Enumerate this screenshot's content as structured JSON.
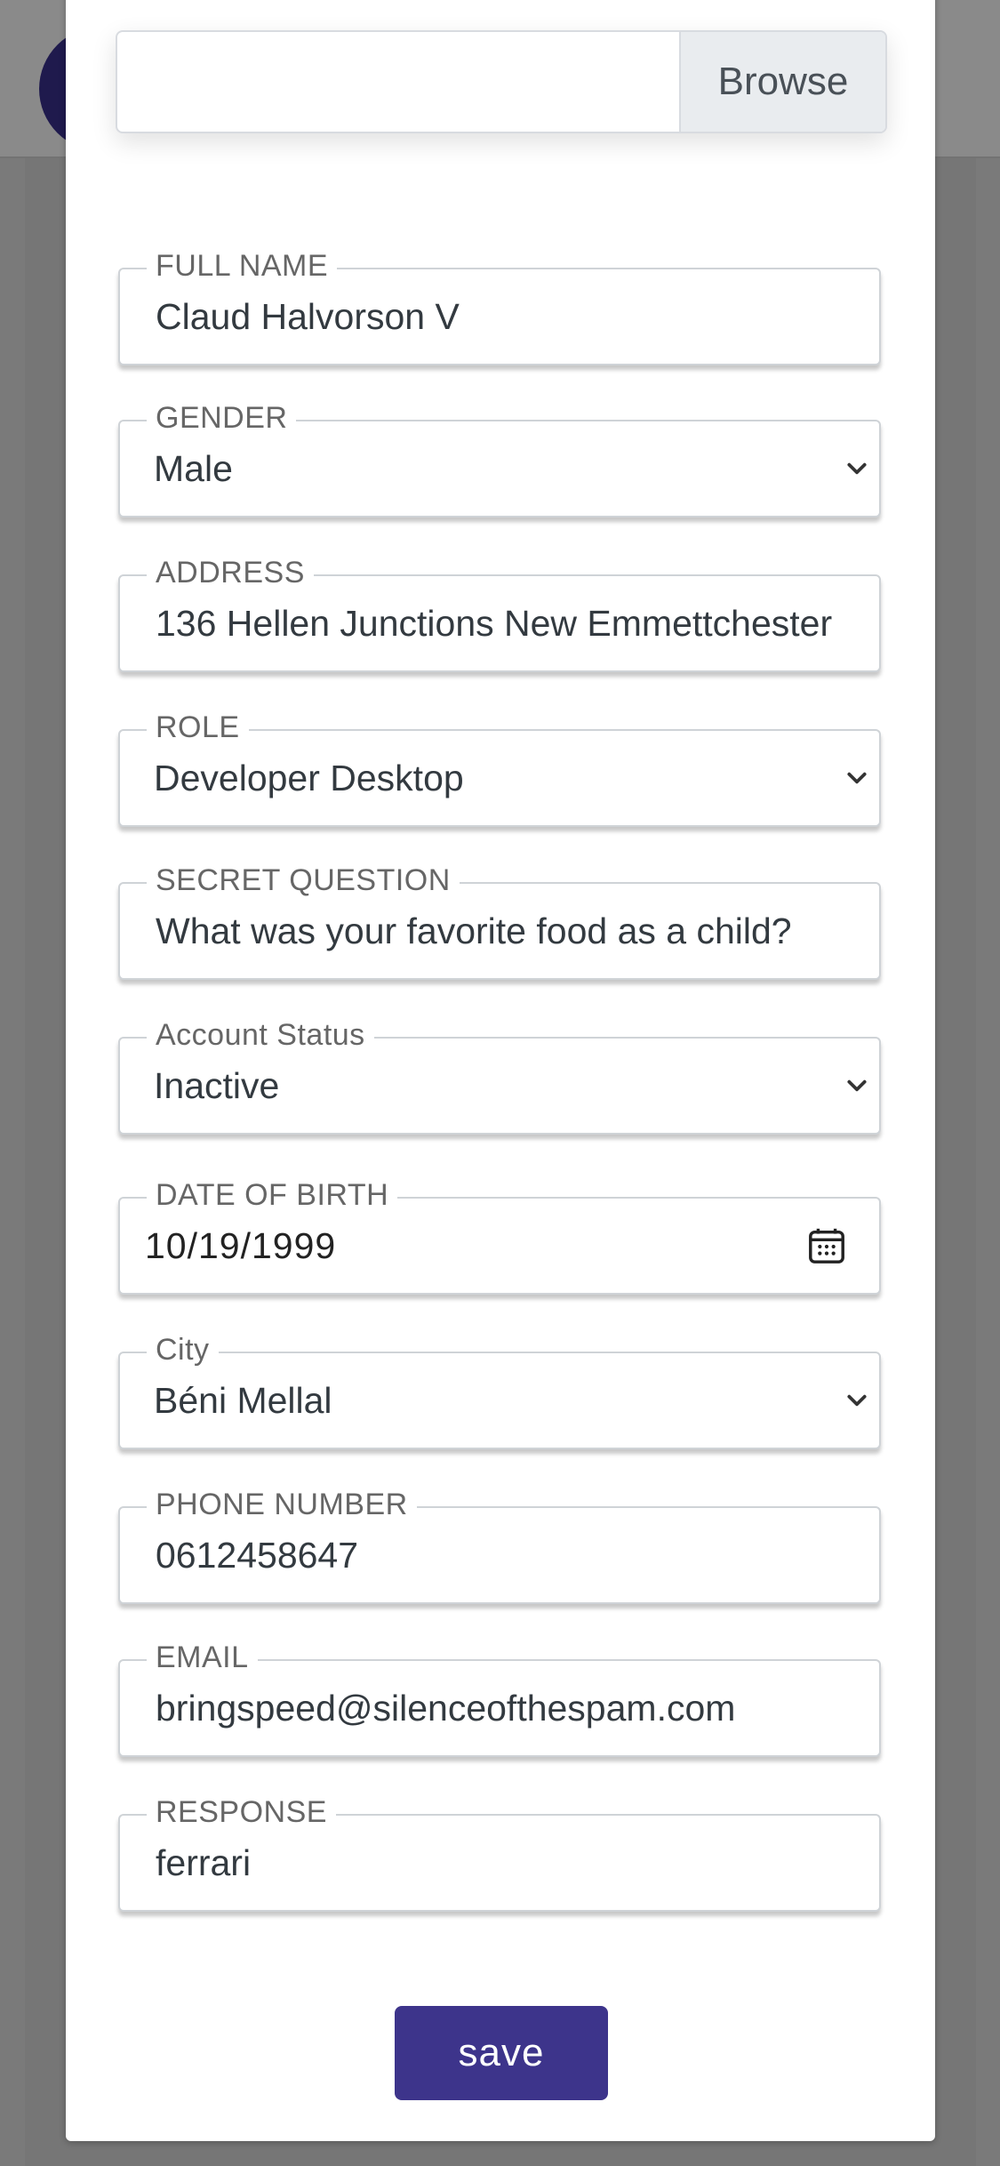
{
  "upload": {
    "browse_label": "Browse",
    "file_value": ""
  },
  "form": {
    "full_name": {
      "label": "FULL NAME",
      "value": "Claud Halvorson V"
    },
    "gender": {
      "label": "GENDER",
      "value": "Male"
    },
    "address": {
      "label": "ADDRESS",
      "value": "136 Hellen Junctions New Emmettchester"
    },
    "role": {
      "label": "ROLE",
      "value": "Developer Desktop"
    },
    "secret_question": {
      "label": "SECRET QUESTION",
      "value": "What was your favorite food as a child?"
    },
    "account_status": {
      "label": "Account Status",
      "value": "Inactive"
    },
    "date_of_birth": {
      "label": "DATE OF BIRTH",
      "value": "10/19/1999"
    },
    "city": {
      "label": "City",
      "value": "Béni Mellal"
    },
    "phone": {
      "label": "PHONE NUMBER",
      "value": "0612458647"
    },
    "email": {
      "label": "EMAIL",
      "value": "bringspeed@silenceofthespam.com"
    },
    "response": {
      "label": "RESPONSE",
      "value": "ferrari"
    },
    "save_label": "save"
  },
  "icons": {
    "dropdown": "chevron-down-icon",
    "date": "calendar-icon"
  },
  "colors": {
    "primary_button": "#3d348b",
    "avatar": "#1f1a4d"
  }
}
